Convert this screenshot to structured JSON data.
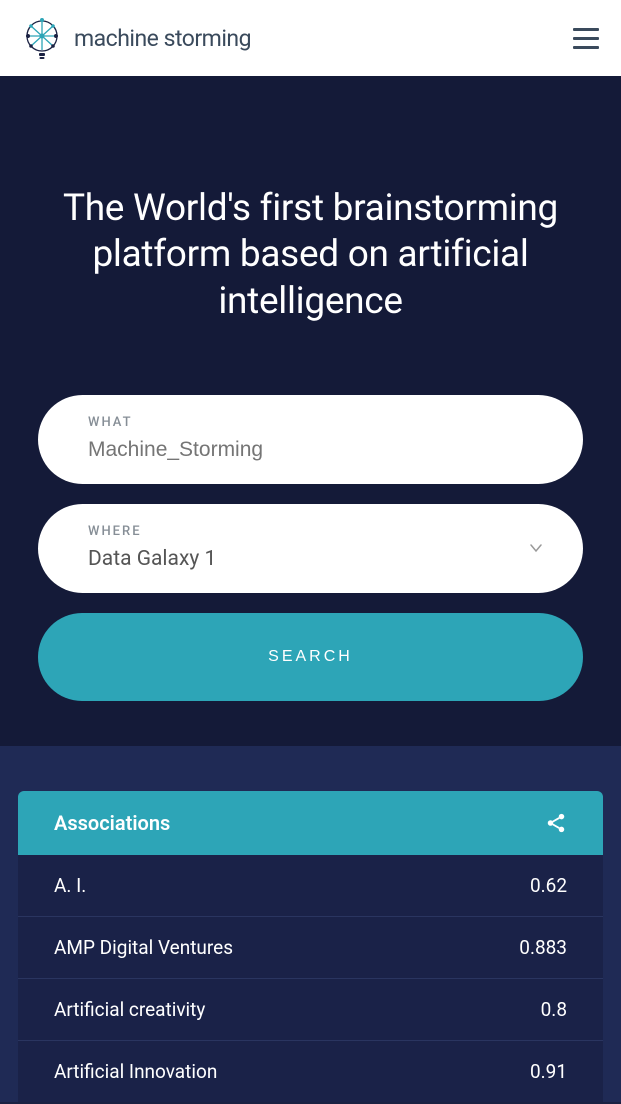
{
  "header": {
    "brand_text": "machine storming"
  },
  "hero": {
    "title": "The World's first brainstorming platform based on artificial intelligence",
    "what": {
      "label": "WHAT",
      "placeholder": "Machine_Storming"
    },
    "where": {
      "label": "WHERE",
      "selected": "Data Galaxy 1"
    },
    "search_label": "SEARCH"
  },
  "results": {
    "header": "Associations",
    "rows": [
      {
        "term": "A. I.",
        "score": "0.62"
      },
      {
        "term": "AMP Digital Ventures",
        "score": "0.883"
      },
      {
        "term": "Artificial creativity",
        "score": "0.8"
      },
      {
        "term": "Artificial Innovation",
        "score": "0.91"
      }
    ]
  }
}
